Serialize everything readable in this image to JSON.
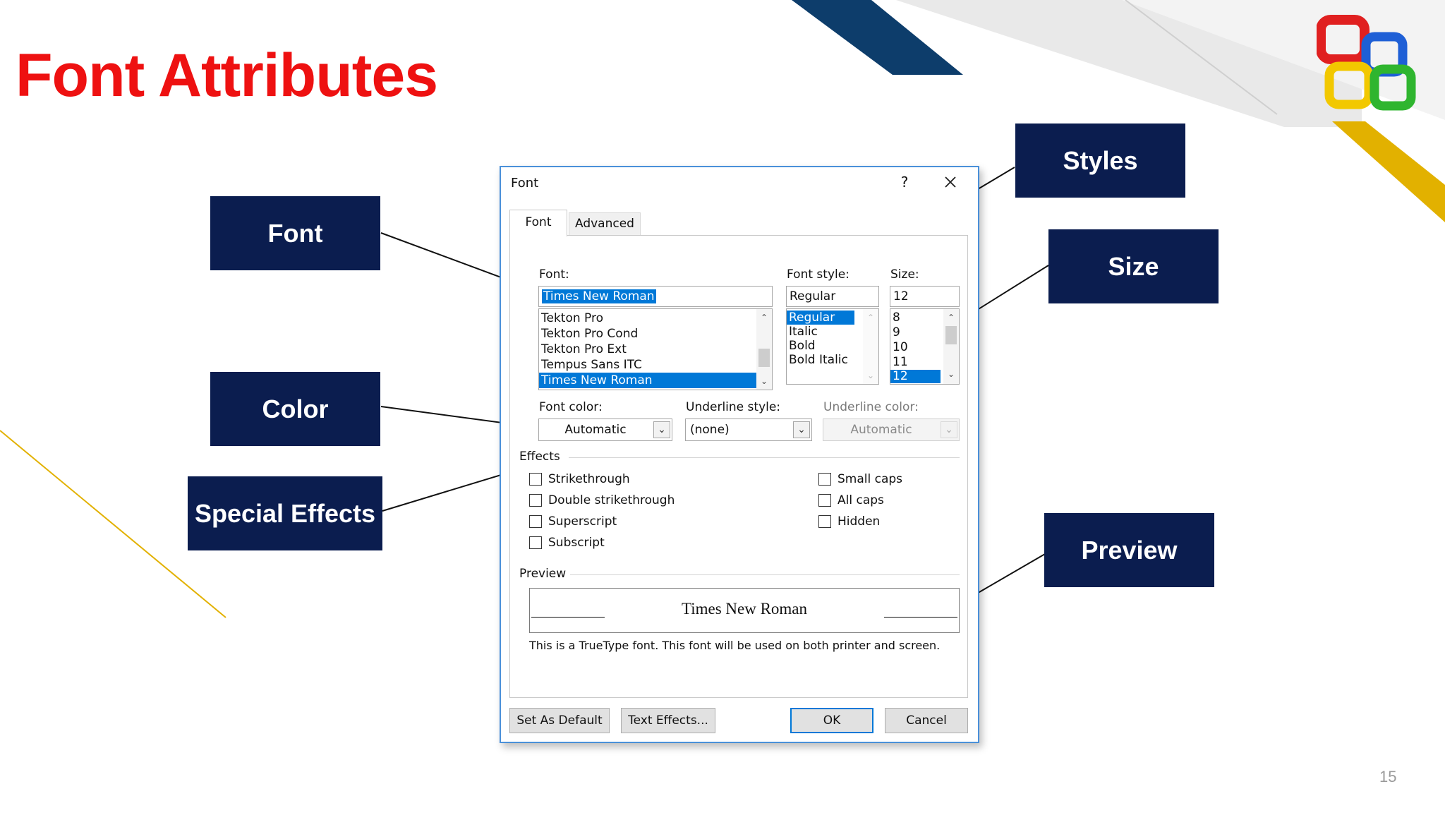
{
  "slide": {
    "title": "Font Attributes",
    "page_number": "15",
    "colors": {
      "title_red": "#ee1111",
      "label_navy": "#0b1d4f",
      "accent_navy": "#0d3d6b",
      "accent_gold": "#e2b100"
    },
    "logo_icon": "office-logo-icon"
  },
  "callouts": {
    "font": "Font",
    "color": "Color",
    "special_effects": "Special Effects",
    "styles": "Styles",
    "size": "Size",
    "preview": "Preview"
  },
  "dialog": {
    "title": "Font",
    "help_label": "?",
    "close_icon": "close-icon",
    "tabs": [
      {
        "label": "Font",
        "active": true
      },
      {
        "label": "Advanced",
        "active": false
      }
    ],
    "font": {
      "label": "Font:",
      "value": "Times New Roman",
      "list": [
        "Tekton Pro",
        "Tekton Pro Cond",
        "Tekton Pro Ext",
        "Tempus Sans ITC",
        "Times New Roman"
      ],
      "selected": "Times New Roman"
    },
    "font_style": {
      "label": "Font style:",
      "value": "Regular",
      "list": [
        "Regular",
        "Italic",
        "Bold",
        "Bold Italic"
      ],
      "selected": "Regular"
    },
    "size": {
      "label": "Size:",
      "value": "12",
      "list": [
        "8",
        "9",
        "10",
        "11",
        "12"
      ],
      "selected": "12"
    },
    "font_color": {
      "label": "Font color:",
      "value": "Automatic"
    },
    "underline_style": {
      "label": "Underline style:",
      "value": "(none)"
    },
    "underline_color": {
      "label": "Underline color:",
      "value": "Automatic",
      "disabled": true
    },
    "effects": {
      "label": "Effects",
      "left": [
        {
          "label": "Strikethrough",
          "checked": false
        },
        {
          "label": "Double strikethrough",
          "checked": false
        },
        {
          "label": "Superscript",
          "checked": false
        },
        {
          "label": "Subscript",
          "checked": false
        }
      ],
      "right": [
        {
          "label": "Small caps",
          "checked": false
        },
        {
          "label": "All caps",
          "checked": false
        },
        {
          "label": "Hidden",
          "checked": false
        }
      ]
    },
    "preview": {
      "label": "Preview",
      "sample": "Times New Roman",
      "note": "This is a TrueType font. This font will be used on both printer and screen."
    },
    "buttons": {
      "set_default": "Set As Default",
      "text_effects": "Text Effects...",
      "ok": "OK",
      "cancel": "Cancel"
    }
  }
}
